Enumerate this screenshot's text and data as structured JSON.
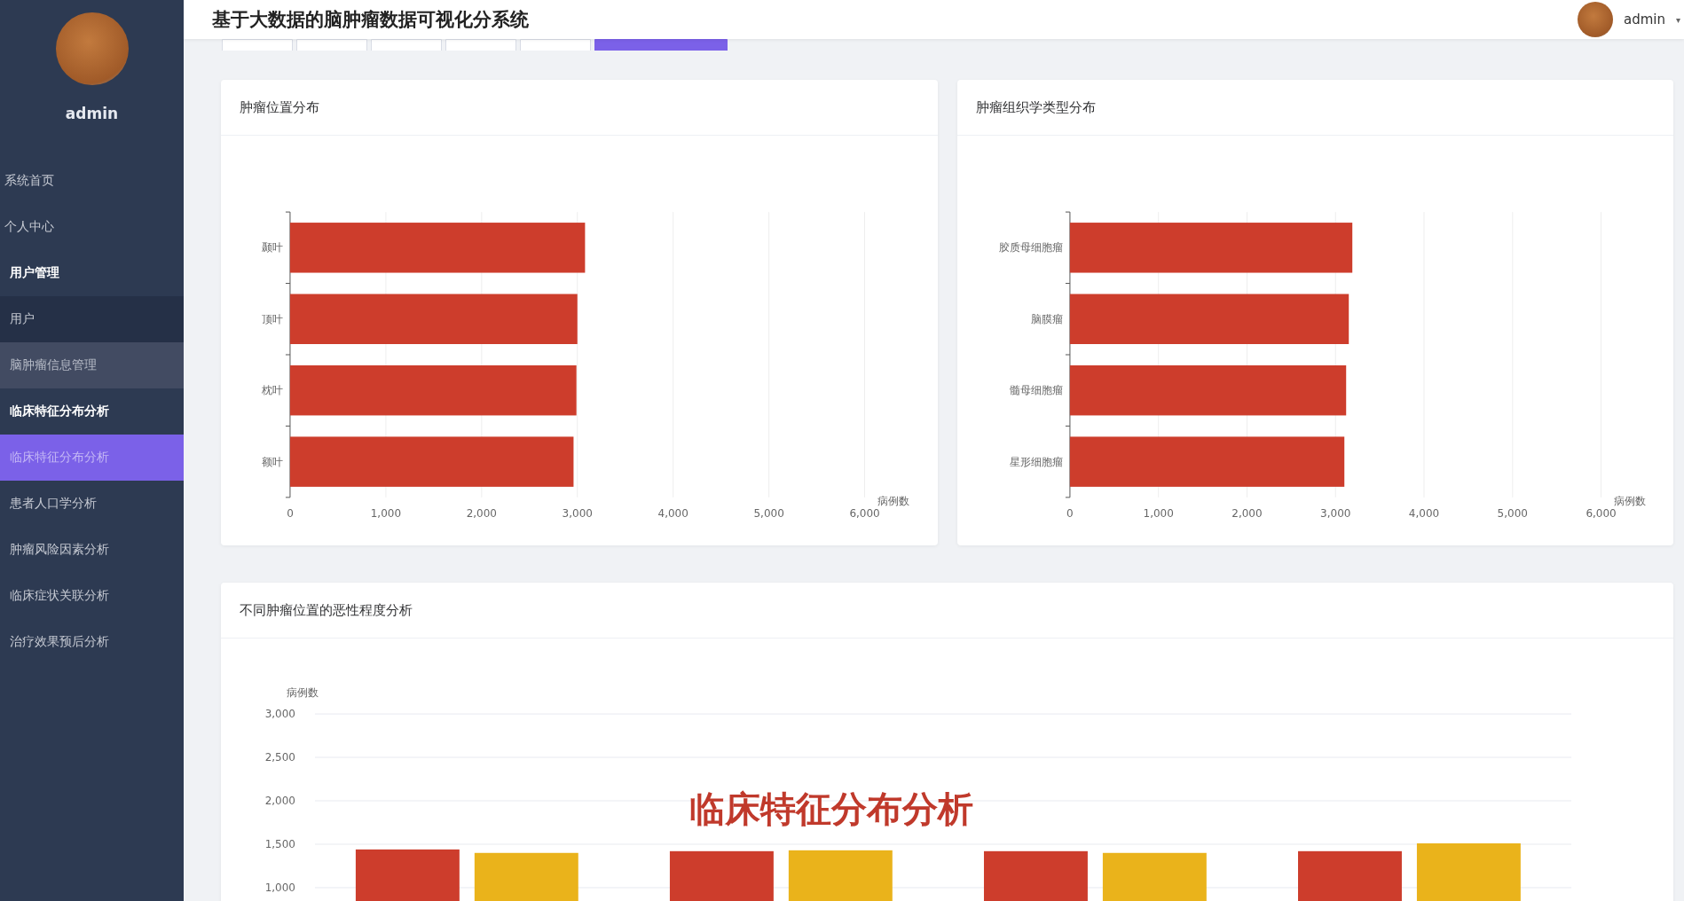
{
  "sidebar": {
    "user": "admin",
    "menu": [
      {
        "kind": "item",
        "label": "系统首页",
        "selected": false
      },
      {
        "kind": "item",
        "label": "个人中心",
        "selected": false
      },
      {
        "kind": "group",
        "label": "用户管理",
        "expanded": true,
        "hovered": false,
        "children": [
          {
            "label": "用户",
            "selected": false
          }
        ]
      },
      {
        "kind": "group",
        "label": "脑肿瘤信息管理",
        "expanded": false,
        "hovered": true
      },
      {
        "kind": "group",
        "label": "临床特征分布分析",
        "expanded": true,
        "hovered": false,
        "children": [
          {
            "label": "临床特征分布分析",
            "selected": true
          }
        ]
      },
      {
        "kind": "item",
        "label": "患者人口学分析",
        "selected": false
      },
      {
        "kind": "item",
        "label": "肿瘤风险因素分析",
        "selected": false
      },
      {
        "kind": "item",
        "label": "临床症状关联分析",
        "selected": false
      },
      {
        "kind": "item",
        "label": "治疗效果预后分析",
        "selected": false
      }
    ]
  },
  "header": {
    "title": "基于大数据的脑肿瘤数据可视化分系统",
    "user": "admin",
    "caret": "▾"
  },
  "tabs": [
    {
      "selected": false
    },
    {
      "selected": false
    },
    {
      "selected": false
    },
    {
      "selected": false
    },
    {
      "selected": false
    },
    {
      "selected": true
    }
  ],
  "cards": [
    {
      "title": "肿瘤位置分布",
      "chart_data": {
        "type": "bar",
        "orientation": "horizontal",
        "xlabel": "病例数",
        "categories": [
          "颞叶",
          "顶叶",
          "枕叶",
          "额叶"
        ],
        "grid": true,
        "series": [
          {
            "color": "#cd3d2c",
            "values": [
              3080,
              3000,
              2990,
              2960
            ]
          }
        ],
        "xlim": [
          0,
          6000
        ],
        "xticks": [
          0,
          {
            "value": 1000,
            "label": "1,000"
          },
          {
            "value": 2000,
            "label": "2,000"
          },
          {
            "value": 3000,
            "label": "3,000"
          },
          {
            "value": 4000,
            "label": "4,000"
          },
          {
            "value": 5000,
            "label": "5,000"
          },
          {
            "value": 6000,
            "label": "6,000"
          }
        ]
      }
    },
    {
      "title": "肿瘤组织学类型分布",
      "chart_data": {
        "type": "bar",
        "orientation": "horizontal",
        "xlabel": "病例数",
        "categories": [
          "胶质母细胞瘤",
          "脑膜瘤",
          "髓母细胞瘤",
          "星形细胞瘤"
        ],
        "grid": true,
        "series": [
          {
            "color": "#cd3d2c",
            "values": [
              3190,
              3150,
              3120,
              3100
            ]
          }
        ],
        "xlim": [
          0,
          6000
        ],
        "xticks": [
          0,
          {
            "value": 1000,
            "label": "1,000"
          },
          {
            "value": 2000,
            "label": "2,000"
          },
          {
            "value": 3000,
            "label": "3,000"
          },
          {
            "value": 4000,
            "label": "4,000"
          },
          {
            "value": 5000,
            "label": "5,000"
          },
          {
            "value": 6000,
            "label": "6,000"
          }
        ]
      }
    }
  ],
  "wide_card": {
    "title": "不同肿瘤位置的恶性程度分析",
    "caption": "临床特征分布分析",
    "chart_data": {
      "type": "bar",
      "ylabel": "病例数",
      "grid": true,
      "series": [
        {
          "color": "#cd3d2c",
          "values": [
            1440,
            1420,
            1420,
            1420
          ]
        },
        {
          "color": "#eab31b",
          "values": [
            1400,
            1430,
            1400,
            1510
          ]
        }
      ],
      "ylim": [
        0,
        3000
      ],
      "yticks": [
        {
          "value": 1000,
          "label": "1,000"
        },
        {
          "value": 1500,
          "label": "1,500"
        },
        {
          "value": 2000,
          "label": "2,000"
        },
        {
          "value": 2500,
          "label": "2,500"
        },
        {
          "value": 3000,
          "label": "3,000"
        }
      ]
    }
  }
}
